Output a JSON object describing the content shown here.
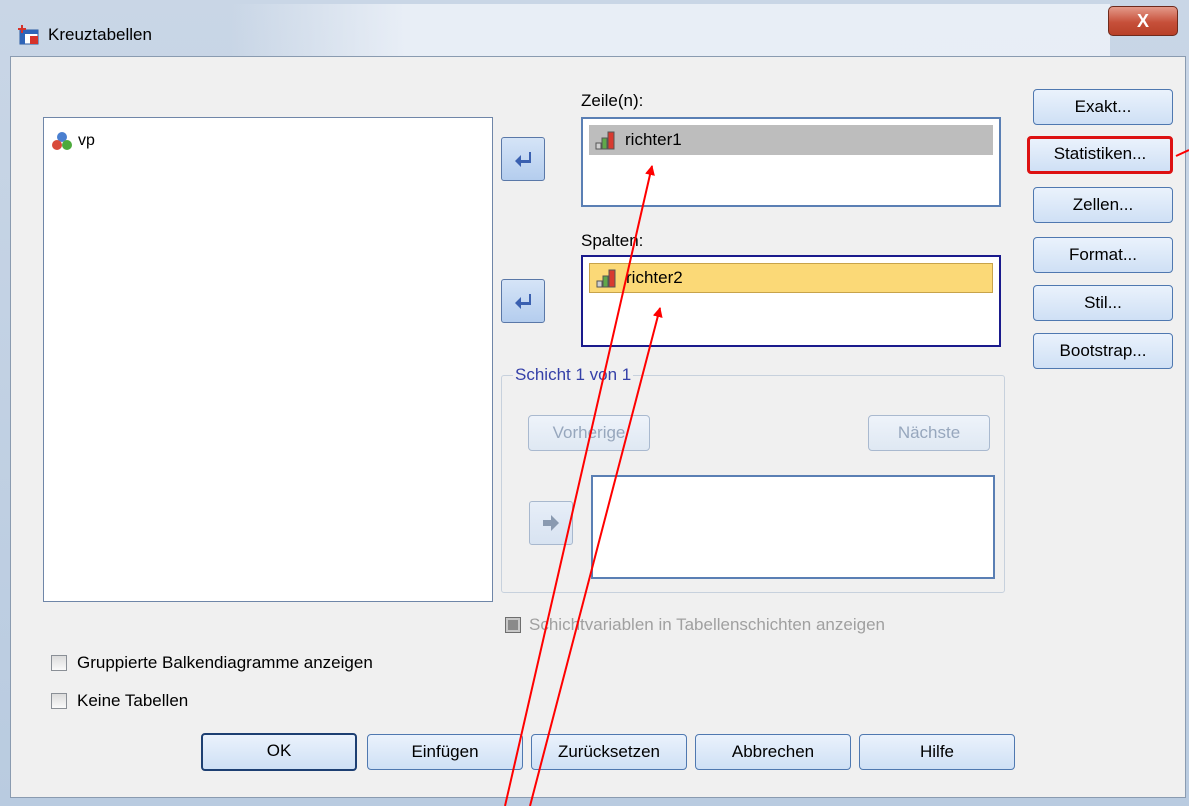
{
  "window": {
    "title": "Kreuztabellen",
    "close_label": "X"
  },
  "variables": {
    "items": [
      {
        "label": "vp",
        "icon": "nominal-variable-icon"
      }
    ]
  },
  "rows": {
    "label": "Zeile(n):",
    "items": [
      {
        "label": "richter1",
        "icon": "ordinal-variable-icon"
      }
    ]
  },
  "columns": {
    "label": "Spalten:",
    "items": [
      {
        "label": "richter2",
        "icon": "ordinal-variable-icon"
      }
    ]
  },
  "layer": {
    "title": "Schicht 1 von 1",
    "prev_label": "Vorherige",
    "next_label": "Nächste"
  },
  "side_buttons": {
    "exact": "Exakt...",
    "statistics": "Statistiken...",
    "cells": "Zellen...",
    "format": "Format...",
    "style": "Stil...",
    "bootstrap": "Bootstrap..."
  },
  "checkboxes": {
    "layer_vars": "Schichtvariablen in Tabellenschichten anzeigen",
    "bar_charts": "Gruppierte Balkendiagramme anzeigen",
    "no_tables": "Keine Tabellen"
  },
  "footer": {
    "ok": "OK",
    "paste": "Einfügen",
    "reset": "Zurücksetzen",
    "cancel": "Abbrechen",
    "help": "Hilfe"
  },
  "colors": {
    "highlight": "#dd1111",
    "annotation": "#ff0000",
    "selection_yellow": "#fbd977"
  }
}
